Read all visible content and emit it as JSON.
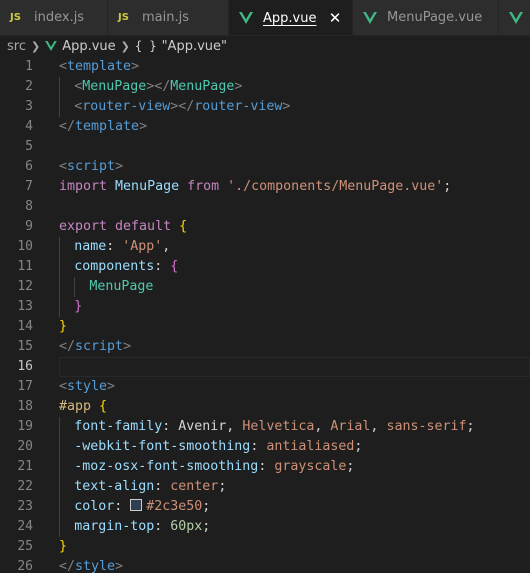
{
  "tabs": [
    {
      "label": "index.js",
      "icon": "js-icon",
      "icon_text": "JS",
      "active": false
    },
    {
      "label": "main.js",
      "icon": "js-icon",
      "icon_text": "JS",
      "active": false
    },
    {
      "label": "App.vue",
      "icon": "vue-icon",
      "active": true,
      "close": "✕"
    },
    {
      "label": "MenuPage.vue",
      "icon": "vue-icon",
      "active": false
    },
    {
      "label": "",
      "icon": "vue-icon",
      "active": false
    }
  ],
  "breadcrumb": {
    "folder": "src",
    "file": "App.vue",
    "symbol_icon": "{ }",
    "symbol": "\"App.vue\""
  },
  "colors": {
    "editor_bg": "#1e1e1e",
    "swatch": "#2c3e50",
    "vue": "#41b883",
    "js": "#cbcb41"
  },
  "editor": {
    "current_line": 16,
    "lines": [
      {
        "n": "1",
        "indent": 0,
        "tokens": [
          [
            "tag",
            "<"
          ],
          [
            "name",
            "template"
          ],
          [
            "tag",
            ">"
          ]
        ]
      },
      {
        "n": "2",
        "indent": 1,
        "tokens": [
          [
            "tag",
            "<"
          ],
          [
            "comp",
            "MenuPage"
          ],
          [
            "tag",
            "></"
          ],
          [
            "comp",
            "MenuPage"
          ],
          [
            "tag",
            ">"
          ]
        ]
      },
      {
        "n": "3",
        "indent": 1,
        "tokens": [
          [
            "tag",
            "<"
          ],
          [
            "name",
            "router-view"
          ],
          [
            "tag",
            "></"
          ],
          [
            "name",
            "router-view"
          ],
          [
            "tag",
            ">"
          ]
        ]
      },
      {
        "n": "4",
        "indent": 0,
        "tokens": [
          [
            "tag",
            "</"
          ],
          [
            "name",
            "template"
          ],
          [
            "tag",
            ">"
          ]
        ]
      },
      {
        "n": "5",
        "indent": 0,
        "tokens": []
      },
      {
        "n": "6",
        "indent": 0,
        "tokens": [
          [
            "tag",
            "<"
          ],
          [
            "name",
            "script"
          ],
          [
            "tag",
            ">"
          ]
        ]
      },
      {
        "n": "7",
        "indent": 0,
        "tokens": [
          [
            "kw",
            "import "
          ],
          [
            "var",
            "MenuPage "
          ],
          [
            "kw",
            "from "
          ],
          [
            "str",
            "'./components/MenuPage.vue'"
          ],
          [
            "plain",
            ";"
          ]
        ]
      },
      {
        "n": "8",
        "indent": 0,
        "tokens": []
      },
      {
        "n": "9",
        "indent": 0,
        "tokens": [
          [
            "kw",
            "export default "
          ],
          [
            "br1",
            "{"
          ]
        ]
      },
      {
        "n": "10",
        "indent": 1,
        "tokens": [
          [
            "var",
            "name"
          ],
          [
            "plain",
            ": "
          ],
          [
            "str",
            "'App'"
          ],
          [
            "plain",
            ","
          ]
        ]
      },
      {
        "n": "11",
        "indent": 1,
        "tokens": [
          [
            "var",
            "components"
          ],
          [
            "plain",
            ": "
          ],
          [
            "br2",
            "{"
          ]
        ]
      },
      {
        "n": "12",
        "indent": 2,
        "tokens": [
          [
            "comp",
            "MenuPage"
          ]
        ]
      },
      {
        "n": "13",
        "indent": 1,
        "tokens": [
          [
            "br2",
            "}"
          ]
        ]
      },
      {
        "n": "14",
        "indent": 0,
        "tokens": [
          [
            "br1",
            "}"
          ]
        ]
      },
      {
        "n": "15",
        "indent": 0,
        "tokens": [
          [
            "tag",
            "</"
          ],
          [
            "name",
            "script"
          ],
          [
            "tag",
            ">"
          ]
        ]
      },
      {
        "n": "16",
        "indent": 0,
        "tokens": []
      },
      {
        "n": "17",
        "indent": 0,
        "tokens": [
          [
            "tag",
            "<"
          ],
          [
            "name",
            "style"
          ],
          [
            "tag",
            ">"
          ]
        ]
      },
      {
        "n": "18",
        "indent": 0,
        "tokens": [
          [
            "sel",
            "#app "
          ],
          [
            "br1",
            "{"
          ]
        ]
      },
      {
        "n": "19",
        "indent": 1,
        "tokens": [
          [
            "var",
            "font-family"
          ],
          [
            "plain",
            ": Avenir, "
          ],
          [
            "str",
            "Helvetica"
          ],
          [
            "plain",
            ", "
          ],
          [
            "str",
            "Arial"
          ],
          [
            "plain",
            ", "
          ],
          [
            "str",
            "sans-serif"
          ],
          [
            "plain",
            ";"
          ]
        ]
      },
      {
        "n": "20",
        "indent": 1,
        "tokens": [
          [
            "var",
            "-webkit-font-smoothing"
          ],
          [
            "plain",
            ": "
          ],
          [
            "str",
            "antialiased"
          ],
          [
            "plain",
            ";"
          ]
        ]
      },
      {
        "n": "21",
        "indent": 1,
        "tokens": [
          [
            "var",
            "-moz-osx-font-smoothing"
          ],
          [
            "plain",
            ": "
          ],
          [
            "str",
            "grayscale"
          ],
          [
            "plain",
            ";"
          ]
        ]
      },
      {
        "n": "22",
        "indent": 1,
        "tokens": [
          [
            "var",
            "text-align"
          ],
          [
            "plain",
            ": "
          ],
          [
            "str",
            "center"
          ],
          [
            "plain",
            ";"
          ]
        ]
      },
      {
        "n": "23",
        "indent": 1,
        "tokens": [
          [
            "var",
            "color"
          ],
          [
            "plain",
            ": "
          ],
          [
            "swatch",
            ""
          ],
          [
            "str",
            "#2c3e50"
          ],
          [
            "plain",
            ";"
          ]
        ]
      },
      {
        "n": "24",
        "indent": 1,
        "tokens": [
          [
            "var",
            "margin-top"
          ],
          [
            "plain",
            ": "
          ],
          [
            "num",
            "60px"
          ],
          [
            "plain",
            ";"
          ]
        ]
      },
      {
        "n": "25",
        "indent": 0,
        "tokens": [
          [
            "br1",
            "}"
          ]
        ]
      },
      {
        "n": "26",
        "indent": 0,
        "tokens": [
          [
            "tag",
            "</"
          ],
          [
            "name",
            "style"
          ],
          [
            "tag",
            ">"
          ]
        ]
      }
    ]
  }
}
